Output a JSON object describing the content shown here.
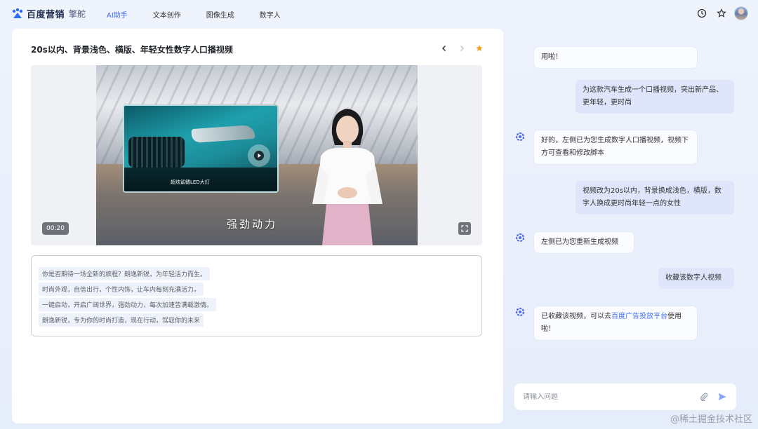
{
  "header": {
    "brand": "百度营销",
    "product": "擎舵",
    "nav": [
      {
        "label": "AI助手",
        "active": true
      },
      {
        "label": "文本创作",
        "active": false
      },
      {
        "label": "图像生成",
        "active": false
      },
      {
        "label": "数字人",
        "active": false
      }
    ],
    "icons": [
      "history-icon",
      "star-icon",
      "avatar"
    ]
  },
  "video_panel": {
    "title": "20s以内、背景浅色、横版、年轻女性数字人口播视频",
    "duration": "00:20",
    "subtitle": "强劲动力",
    "car_caption": "超炫鲨鳍LED大灯"
  },
  "script": {
    "lines": [
      "你是否期待一场全新的旅程？朗逸新锐，为年轻活力而生。",
      "时尚外观，自信出行，个性内饰，让车内每刻充满活力。",
      "一键启动，开启广阔世界，强劲动力，每次加速皆满载激情。",
      "朗逸新锐，专为你的时尚打造，现在行动，驾驭你的未来"
    ]
  },
  "chat": {
    "messages": [
      {
        "role": "bot",
        "text": "用啦！"
      },
      {
        "role": "user",
        "text": "为这款汽车生成一个口播视频，突出新产品、更年轻，更时尚"
      },
      {
        "role": "bot",
        "text": "好的，左侧已为您生成数字人口播视频，视频下方可查看和修改脚本"
      },
      {
        "role": "user",
        "text": "视频改为20s以内，背景换成浅色，横版，数字人换成更时尚年轻一点的女性"
      },
      {
        "role": "bot",
        "text": "左侧已为您重新生成视频"
      },
      {
        "role": "user",
        "text": "收藏该数字人视频"
      },
      {
        "role": "bot",
        "text_before": "已收藏该视频，可以去",
        "link": "百度广告投放平台",
        "text_after": "使用啦！"
      }
    ],
    "input_placeholder": "请输入问题"
  },
  "watermark": "@稀土掘金技术社区",
  "colors": {
    "accent": "#3f6ef5",
    "user_bubble": "#dfe6fb",
    "favorite": "#f5a020"
  }
}
